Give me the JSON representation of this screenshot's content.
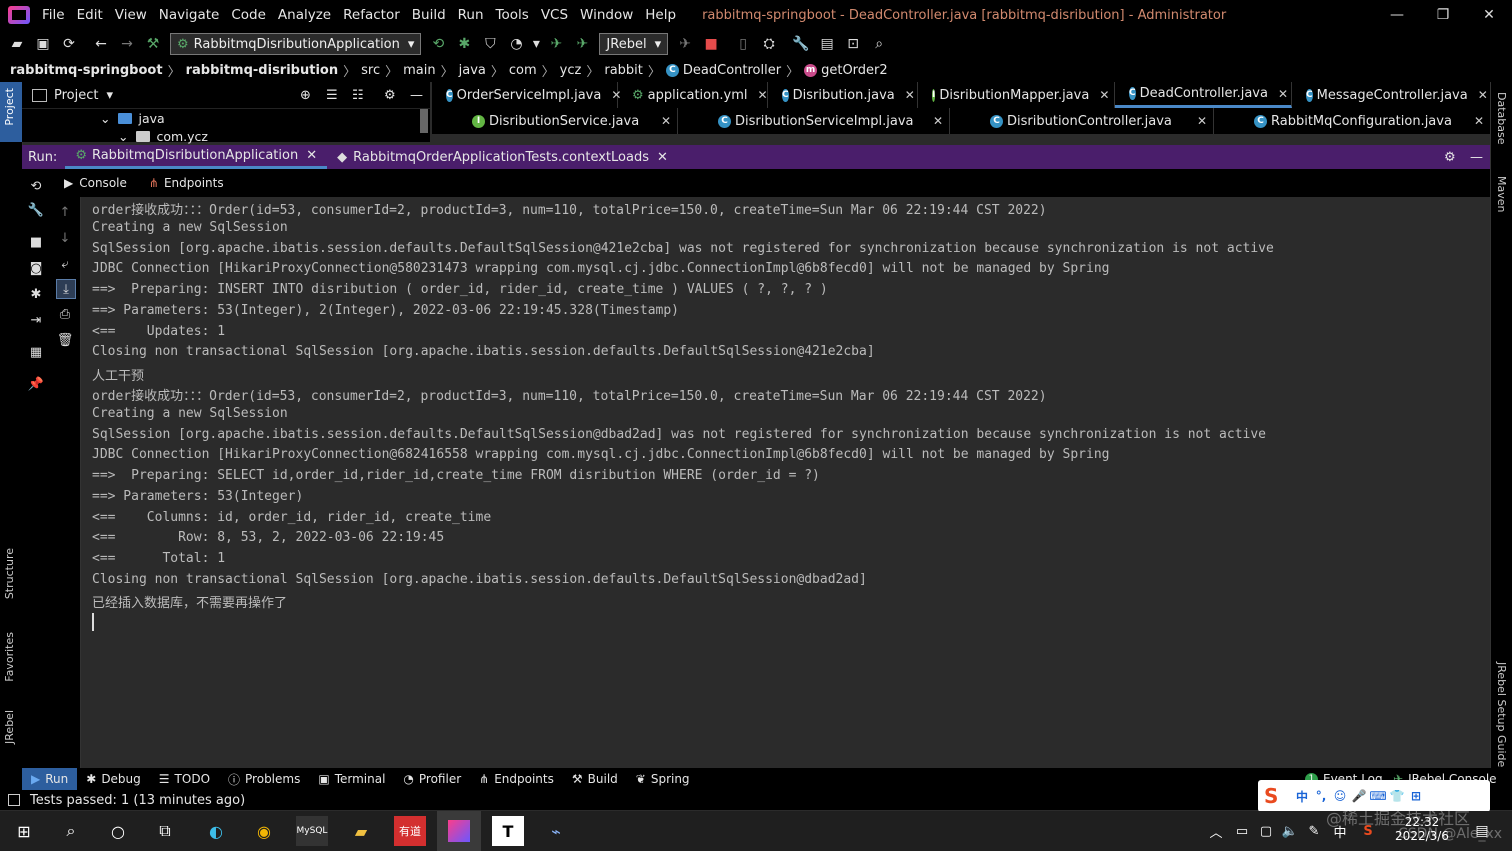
{
  "window": {
    "title": "rabbitmq-springboot - DeadController.java [rabbitmq-disribution] - Administrator",
    "menu": [
      "File",
      "Edit",
      "View",
      "Navigate",
      "Code",
      "Analyze",
      "Refactor",
      "Build",
      "Run",
      "Tools",
      "VCS",
      "Window",
      "Help"
    ],
    "controls": {
      "minimize": "—",
      "restore": "❐",
      "close": "✕"
    }
  },
  "toolbar": {
    "run_config": "RabbitmqDisributionApplication",
    "jrebel_label": "JRebel"
  },
  "breadcrumb": [
    "rabbitmq-springboot",
    "rabbitmq-disribution",
    "src",
    "main",
    "java",
    "com",
    "ycz",
    "rabbit",
    "DeadController",
    "getOrder2"
  ],
  "project_panel": {
    "title": "Project",
    "items": [
      "java",
      "com.ycz"
    ],
    "side_label": "Project"
  },
  "editor_tabs_row1": [
    {
      "label": "OrderServiceImpl.java",
      "kind": "c"
    },
    {
      "label": "application.yml",
      "kind": "y"
    },
    {
      "label": "Disribution.java",
      "kind": "c"
    },
    {
      "label": "DisributionMapper.java",
      "kind": "i"
    },
    {
      "label": "DeadController.java",
      "kind": "c",
      "active": true
    },
    {
      "label": "MessageController.java",
      "kind": "c"
    }
  ],
  "editor_tabs_row2": [
    {
      "label": "DisributionService.java",
      "kind": "i"
    },
    {
      "label": "DisributionServiceImpl.java",
      "kind": "c"
    },
    {
      "label": "DisributionController.java",
      "kind": "c"
    },
    {
      "label": "RabbitMqConfiguration.java",
      "kind": "c"
    }
  ],
  "run_bar": {
    "label": "Run:",
    "tabs": [
      "RabbitmqDisributionApplication",
      "RabbitmqOrderApplicationTests.contextLoads"
    ]
  },
  "console_tabs": [
    "Console",
    "Endpoints"
  ],
  "console_lines": [
    "order接收成功：：：Order(id=53, consumerId=2, productId=3, num=110, totalPrice=150.0, createTime=Sun Mar 06 22:19:44 CST 2022)",
    "Creating a new SqlSession",
    "SqlSession [org.apache.ibatis.session.defaults.DefaultSqlSession@421e2cba] was not registered for synchronization because synchronization is not active",
    "JDBC Connection [HikariProxyConnection@580231473 wrapping com.mysql.cj.jdbc.ConnectionImpl@6b8fecd0] will not be managed by Spring",
    "==>  Preparing: INSERT INTO disribution ( order_id, rider_id, create_time ) VALUES ( ?, ?, ? )",
    "==> Parameters: 53(Integer), 2(Integer), 2022-03-06 22:19:45.328(Timestamp)",
    "<==    Updates: 1",
    "Closing non transactional SqlSession [org.apache.ibatis.session.defaults.DefaultSqlSession@421e2cba]",
    "人工干预",
    "order接收成功：：：Order(id=53, consumerId=2, productId=3, num=110, totalPrice=150.0, createTime=Sun Mar 06 22:19:44 CST 2022)",
    "Creating a new SqlSession",
    "SqlSession [org.apache.ibatis.session.defaults.DefaultSqlSession@dbad2ad] was not registered for synchronization because synchronization is not active",
    "JDBC Connection [HikariProxyConnection@682416558 wrapping com.mysql.cj.jdbc.ConnectionImpl@6b8fecd0] will not be managed by Spring",
    "==>  Preparing: SELECT id,order_id,rider_id,create_time FROM disribution WHERE (order_id = ?)",
    "==> Parameters: 53(Integer)",
    "<==    Columns: id, order_id, rider_id, create_time",
    "<==        Row: 8, 53, 2, 2022-03-06 22:19:45",
    "<==      Total: 1",
    "Closing non transactional SqlSession [org.apache.ibatis.session.defaults.DefaultSqlSession@dbad2ad]",
    "已经插入数据库，不需要再操作了"
  ],
  "side_labels": {
    "left": [
      "Structure",
      "Favorites",
      "JRebel"
    ],
    "right": [
      "Database",
      "Maven",
      "JRebel Setup Guide"
    ]
  },
  "bottom_tabs": [
    "Run",
    "Debug",
    "TODO",
    "Problems",
    "Terminal",
    "Profiler",
    "Endpoints",
    "Build",
    "Spring"
  ],
  "bottom_right_tabs": [
    "Event Log",
    "JRebel Console"
  ],
  "event_log_count": "1",
  "status": "Tests passed: 1 (13 minutes ago)",
  "ime_chars": [
    "中",
    "°,",
    "☺",
    "🎤",
    "⌨",
    "👕",
    "⊞"
  ],
  "clock": {
    "time": "22:32",
    "date": "2022/3/6"
  },
  "tray_ime": "中",
  "watermark": "@稀土掘金技术社区",
  "watermark2": "CSDN @Ale_xx",
  "colors": {
    "accent": "#4a88c7",
    "run_bar": "#4a1e6b",
    "title_text": "#d28a6f",
    "green": "#59a869",
    "red": "#e54b4b"
  }
}
